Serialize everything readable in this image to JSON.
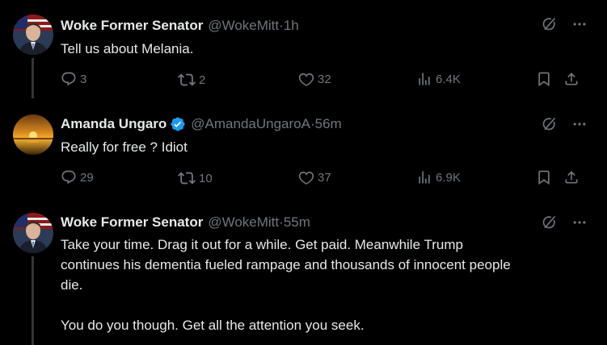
{
  "tweets": [
    {
      "name": "Woke Former Senator",
      "handle": "@WokeMitt",
      "time": "1h",
      "text": "Tell us about Melania.",
      "replies": "3",
      "retweets": "2",
      "likes": "32",
      "views": "6.4K",
      "verified": false
    },
    {
      "name": "Amanda Ungaro",
      "handle": "@AmandaUngaroA",
      "time": "56m",
      "text": "Really for free ? Idiot",
      "replies": "29",
      "retweets": "10",
      "likes": "37",
      "views": "6.9K",
      "verified": true
    },
    {
      "name": "Woke Former Senator",
      "handle": "@WokeMitt",
      "time": "55m",
      "text_lines": [
        "Take your time. Drag it out for a while. Get paid. Meanwhile Trump",
        "continues his dementia fueled rampage and thousands of innocent people",
        "die.",
        "",
        "You do you though. Get all the attention you seek."
      ],
      "verified": false
    }
  ],
  "separator": " · ",
  "colors": {
    "background": "#000000",
    "text": "#e7e9ea",
    "muted": "#71767b",
    "verified": "#1d9bf0",
    "thread_line": "#333639"
  },
  "icons": [
    "grok-icon",
    "more-icon",
    "reply-icon",
    "retweet-icon",
    "like-icon",
    "views-icon",
    "bookmark-icon",
    "share-icon",
    "verified-badge-icon"
  ]
}
